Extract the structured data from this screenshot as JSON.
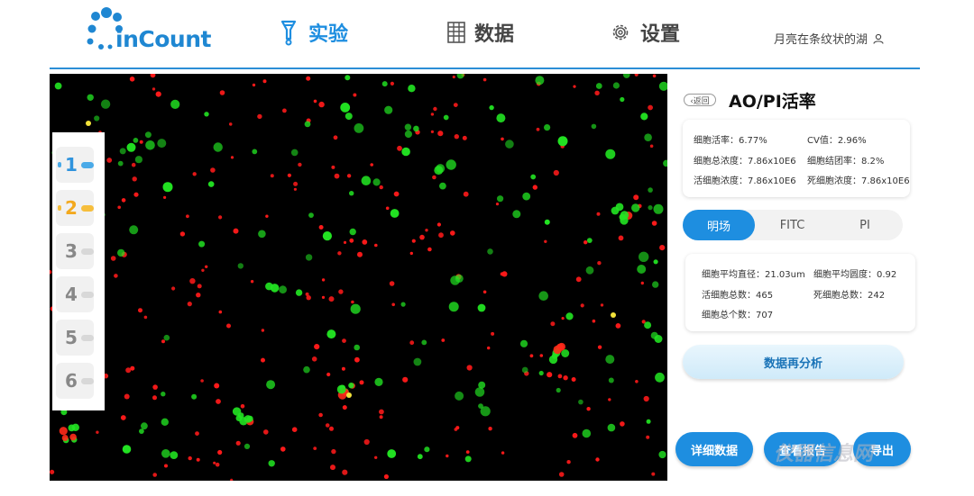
{
  "header": {
    "logo_text": "inCount",
    "nav": [
      {
        "label": "实验",
        "icon": "flask-icon",
        "active": true
      },
      {
        "label": "数据",
        "icon": "grid-table-icon",
        "active": false
      },
      {
        "label": "设置",
        "icon": "gear-icon",
        "active": false
      }
    ],
    "user_name": "月亮在条纹状的湖",
    "accent_color": "#1e8ee0"
  },
  "channels": [
    {
      "number": "1",
      "state": "active-blue"
    },
    {
      "number": "2",
      "state": "active-orange"
    },
    {
      "number": "3",
      "state": "idle"
    },
    {
      "number": "4",
      "state": "idle"
    },
    {
      "number": "5",
      "state": "idle"
    },
    {
      "number": "6",
      "state": "idle"
    }
  ],
  "panel": {
    "back_label": "返回",
    "title": "AO/PI活率",
    "stats": {
      "viability": "细胞活率：6.77%",
      "cv": "CV值：2.96%",
      "total_concentration": "细胞总浓度：7.86x10E6",
      "aggregation_rate": "细胞结团率：8.2%",
      "live_concentration": "活细胞浓度：7.86x10E6",
      "dead_concentration": "死细胞浓度：7.86x10E6"
    },
    "tabs": [
      {
        "label": "明场",
        "active": true
      },
      {
        "label": "FITC",
        "active": false
      },
      {
        "label": "PI",
        "active": false
      }
    ],
    "details": {
      "avg_diameter": "细胞平均直径：21.03um",
      "avg_roundness": "细胞平均圆度：0.92",
      "live_count": "活细胞总数：465",
      "dead_count": "死细胞总数：242",
      "total_count": "细胞总个数：707"
    },
    "reanalyze_label": "数据再分析",
    "buttons": {
      "details": "详细数据",
      "report": "查看报告",
      "export": "导出"
    }
  },
  "watermark": "仪器信息网"
}
